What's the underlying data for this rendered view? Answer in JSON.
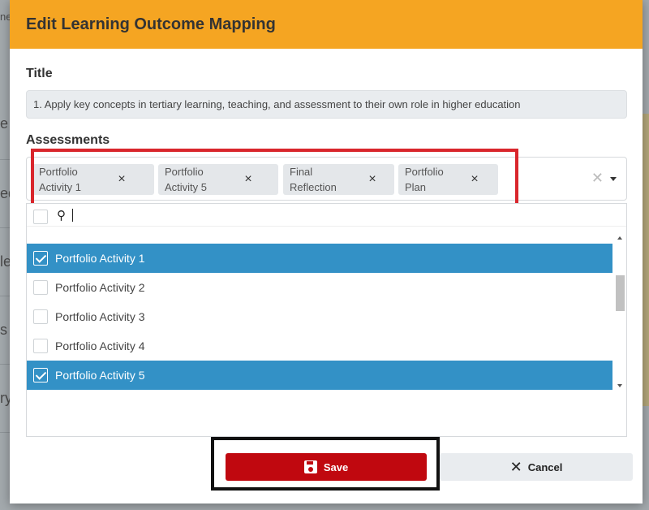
{
  "background_fragments": [
    "ne",
    "e i",
    "ed",
    "le",
    "s",
    "ry"
  ],
  "modal": {
    "title": "Edit Learning Outcome Mapping",
    "title_label": "Title",
    "title_value": "1. Apply key concepts in tertiary learning, teaching, and assessment to their own role in higher education",
    "assessments_label": "Assessments"
  },
  "selected_chips": [
    {
      "label": "Portfolio\nActivity 1"
    },
    {
      "label": "Portfolio\nActivity 5"
    },
    {
      "label": "Final\nReflection"
    },
    {
      "label": "Portfolio\nPlan"
    }
  ],
  "icons": {
    "remove": "×",
    "clear": "✕",
    "search": "🔍",
    "cancel": "✕"
  },
  "options": [
    {
      "label": "Portfolio Activity 1",
      "checked": true
    },
    {
      "label": "Portfolio Activity 2",
      "checked": false
    },
    {
      "label": "Portfolio Activity 3",
      "checked": false
    },
    {
      "label": "Portfolio Activity 4",
      "checked": false
    },
    {
      "label": "Portfolio Activity 5",
      "checked": true
    }
  ],
  "footer": {
    "save_label": "Save",
    "cancel_label": "Cancel"
  },
  "colors": {
    "header": "#f5a522",
    "selected_row": "#3391c6",
    "save_button": "#c0080f",
    "highlight_red": "#d9262c"
  }
}
